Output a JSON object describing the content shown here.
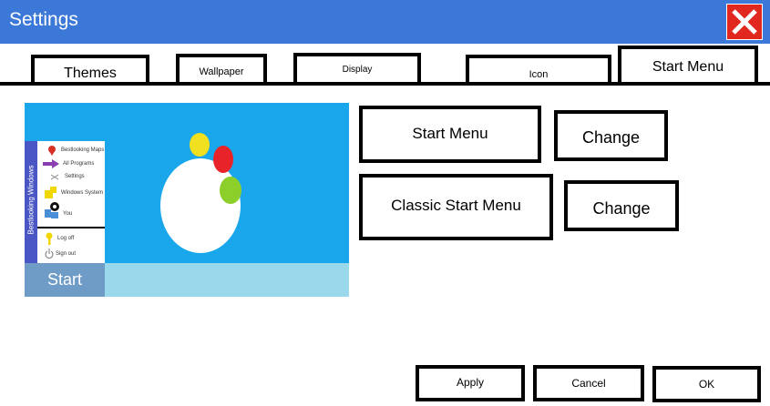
{
  "window": {
    "title": "Settings",
    "close_icon": "close-x-icon",
    "accent": "#3c78d8",
    "close_color": "#e0281e"
  },
  "tabs": [
    {
      "label": "Themes"
    },
    {
      "label": "Wallpaper"
    },
    {
      "label": "Display"
    },
    {
      "label": "Icon"
    },
    {
      "label": "Start Menu",
      "active": true
    }
  ],
  "preview": {
    "desktop_color": "#1aa6ea",
    "side_label": "Bestlooking Windows",
    "start_menu_items": [
      {
        "label": "Bestlooking Maps",
        "icon": "map-pin-icon"
      },
      {
        "label": "All Programs",
        "icon": "arrow-right-icon"
      },
      {
        "label": "Settings",
        "icon": "gear-icon"
      },
      {
        "label": "Windows System",
        "icon": "puzzle-icon"
      },
      {
        "label": "You",
        "icon": "user-icon"
      },
      {
        "label": "Log off",
        "icon": "key-icon"
      },
      {
        "label": "Sign out",
        "icon": "power-icon"
      }
    ],
    "start_label": "Start",
    "taskbar_color": "#9ad9ec"
  },
  "options": [
    {
      "label": "Start Menu",
      "action": "Change"
    },
    {
      "label": "Classic Start Menu",
      "action": "Change"
    }
  ],
  "footer": {
    "apply": "Apply",
    "cancel": "Cancel",
    "ok": "OK"
  }
}
